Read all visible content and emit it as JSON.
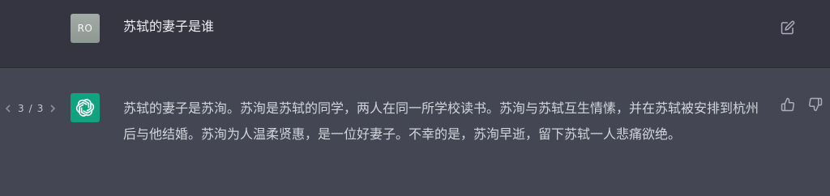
{
  "user_message": {
    "avatar_initials": "RO",
    "text": "苏轼的妻子是谁"
  },
  "assistant_message": {
    "pager": {
      "current": "3",
      "separator": "/",
      "total": "3"
    },
    "text": "苏轼的妻子是苏洵。苏洵是苏轼的同学，两人在同一所学校读书。苏洵与苏轼互生情愫，并在苏轼被安排到杭州后与他结婚。苏洵为人温柔贤惠，是一位好妻子。不幸的是，苏洵早逝，留下苏轼一人悲痛欲绝。"
  },
  "icons": {
    "edit": "edit-icon",
    "thumbs_up": "thumbs-up-icon",
    "thumbs_down": "thumbs-down-icon",
    "prev": "chevron-left-icon",
    "next": "chevron-right-icon",
    "assistant_logo": "openai-logo-icon"
  },
  "colors": {
    "user_row_bg": "#343541",
    "assistant_row_bg": "#444654",
    "assistant_avatar": "#10a37f",
    "user_avatar": "#9aa39e"
  }
}
